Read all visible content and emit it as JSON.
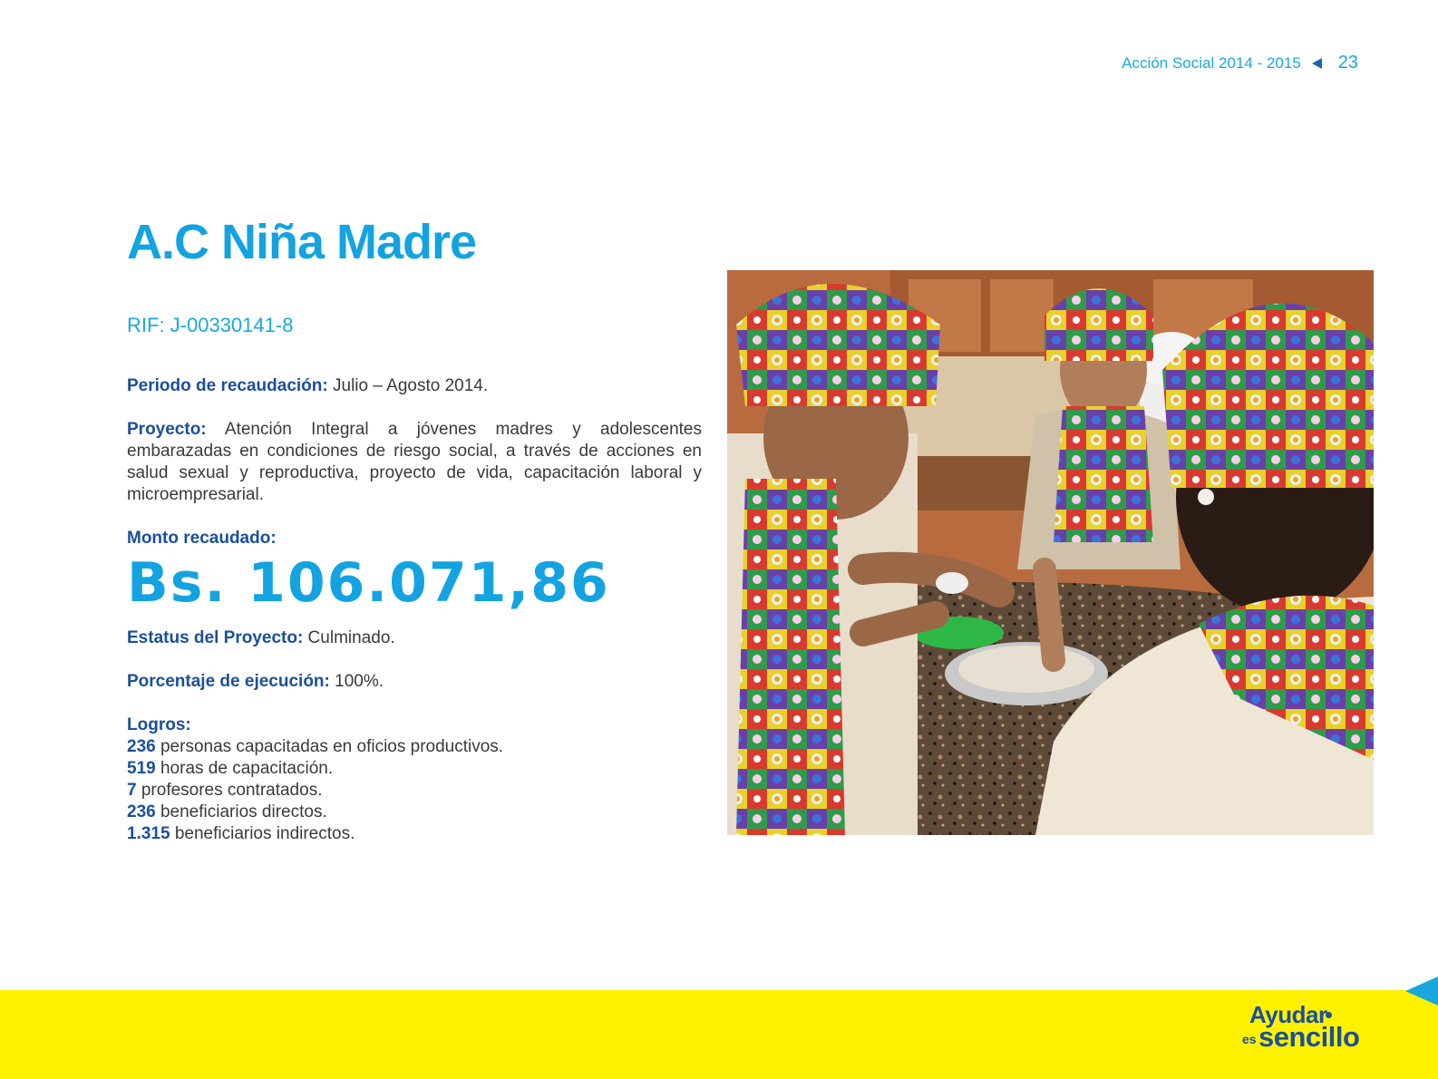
{
  "header": {
    "section": "Acción Social 2014 - 2015",
    "page_number": "23"
  },
  "title": "A.C Niña Madre",
  "rif": "RIF: J-00330141-8",
  "periodo": {
    "label": "Periodo de recaudación:",
    "value": " Julio – Agosto 2014."
  },
  "proyecto": {
    "label": "Proyecto:",
    "value": " Atención Integral a jóvenes madres y adolescentes embarazadas en condiciones de riesgo social, a través  de acciones en salud sexual y reproductiva, proyecto de vida, capacitación laboral y microempresarial."
  },
  "monto": {
    "label": "Monto recaudado:",
    "value": "Bs. 106.071,86"
  },
  "estatus": {
    "label": "Estatus del Proyecto:",
    "value": " Culminado."
  },
  "porcentaje": {
    "label": "Porcentaje de ejecución:",
    "value": " 100%."
  },
  "logros": {
    "label": "Logros:",
    "items": [
      {
        "num": "236",
        "text": " personas capacitadas en oficios productivos."
      },
      {
        "num": "519",
        "text": " horas de capacitación."
      },
      {
        "num": "7",
        "text": " profesores contratados."
      },
      {
        "num": "236",
        "text": " beneficiarios directos."
      },
      {
        "num": "1.315",
        "text": " beneficiarios indirectos."
      }
    ]
  },
  "footer_logo": {
    "line1": "Ayudar",
    "line2": "es",
    "line3": "sencillo"
  },
  "colors": {
    "accent_blue": "#13a3e0",
    "dark_blue": "#1b4f9c",
    "footer_yellow": "#fff100"
  }
}
